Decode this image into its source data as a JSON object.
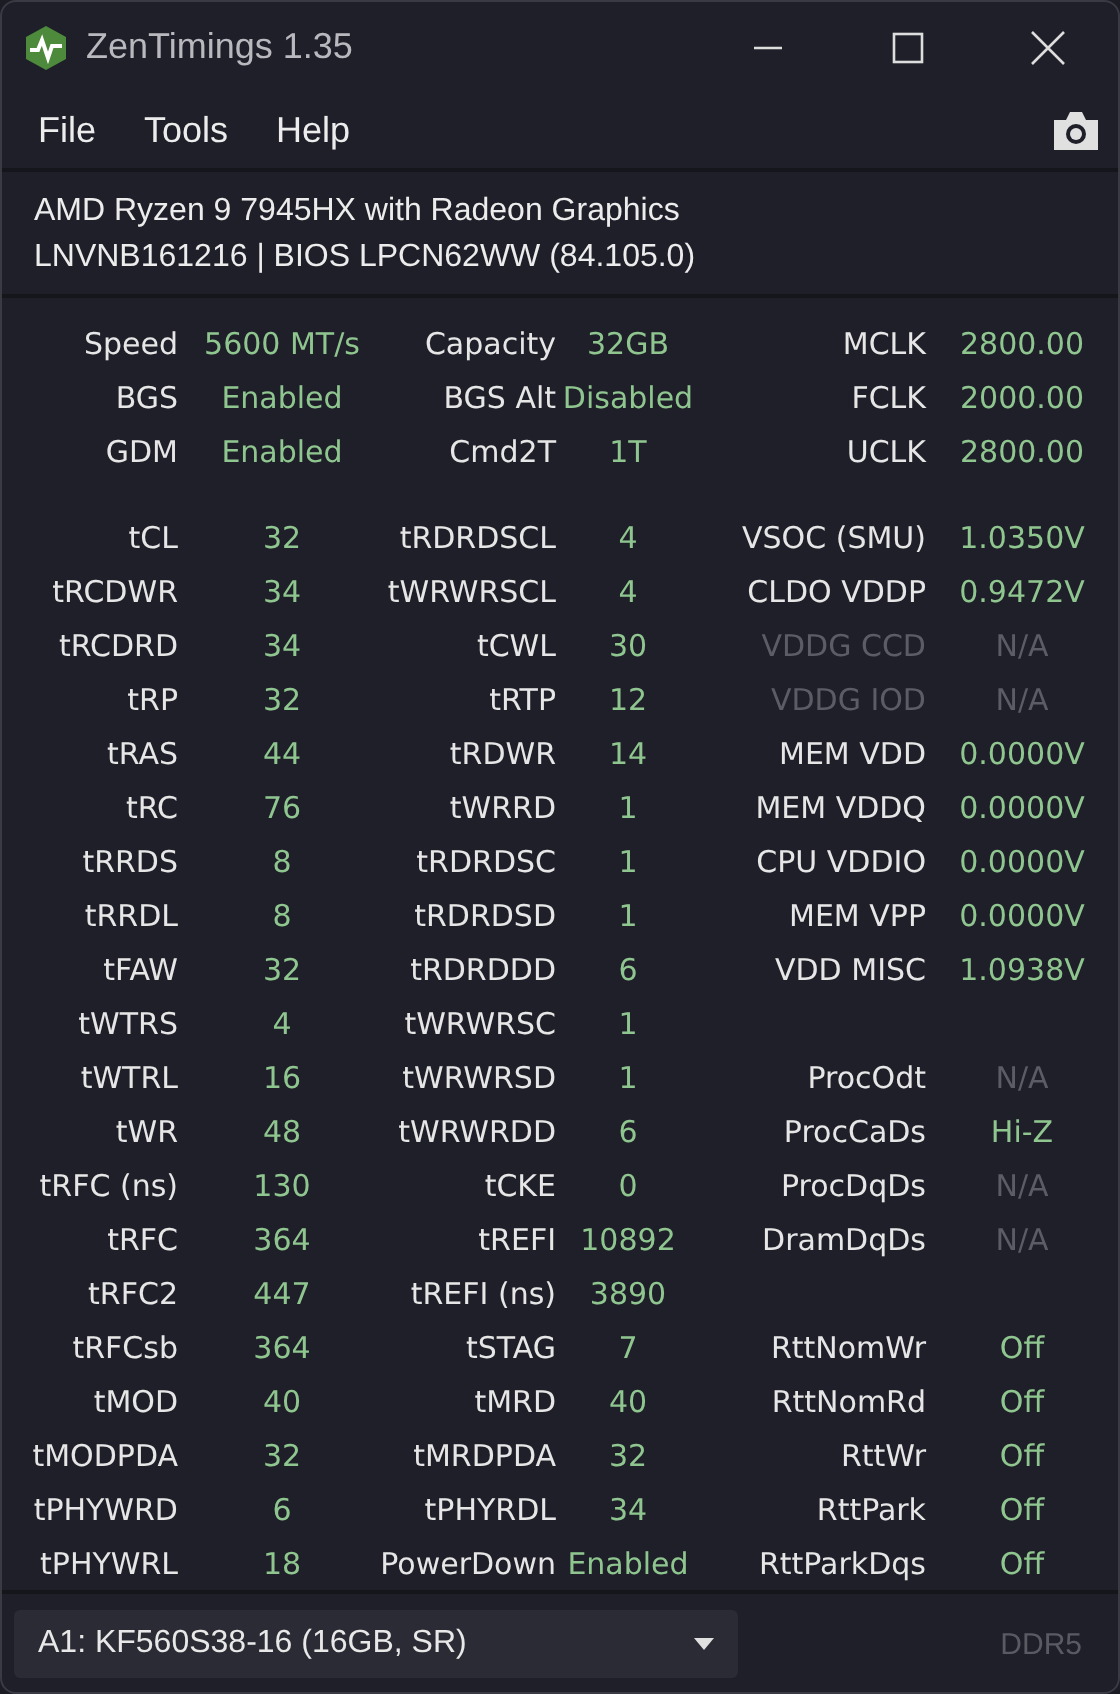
{
  "window": {
    "title": "ZenTimings 1.35"
  },
  "menu": [
    "File",
    "Tools",
    "Help"
  ],
  "info": [
    "AMD Ryzen 9 7945HX with Radeon Graphics",
    "LNVNB161216 | BIOS LPCN62WW (84.105.0)"
  ],
  "summary": [
    {
      "cells": [
        {
          "label": "Speed",
          "value": "5600 MT/s"
        },
        {
          "label": "Capacity",
          "value": "32GB"
        },
        {
          "label": "MCLK",
          "value": "2800.00"
        }
      ]
    },
    {
      "cells": [
        {
          "label": "BGS",
          "value": "Enabled"
        },
        {
          "label": "BGS Alt",
          "value": "Disabled"
        },
        {
          "label": "FCLK",
          "value": "2000.00"
        }
      ]
    },
    {
      "cells": [
        {
          "label": "GDM",
          "value": "Enabled"
        },
        {
          "label": "Cmd2T",
          "value": "1T"
        },
        {
          "label": "UCLK",
          "value": "2800.00"
        }
      ]
    }
  ],
  "timings": [
    {
      "cells": [
        {
          "label": "tCL",
          "value": "32",
          "kind": "normal"
        },
        {
          "label": "tRDRDSCL",
          "value": "4",
          "kind": "normal"
        },
        {
          "label": "VSOC (SMU)",
          "value": "1.0350V",
          "kind": "normal"
        }
      ]
    },
    {
      "cells": [
        {
          "label": "tRCDWR",
          "value": "34",
          "kind": "normal"
        },
        {
          "label": "tWRWRSCL",
          "value": "4",
          "kind": "normal"
        },
        {
          "label": "CLDO VDDP",
          "value": "0.9472V",
          "kind": "normal"
        }
      ]
    },
    {
      "cells": [
        {
          "label": "tRCDRD",
          "value": "34",
          "kind": "normal"
        },
        {
          "label": "tCWL",
          "value": "30",
          "kind": "normal"
        },
        {
          "label": "VDDG CCD",
          "value": "N/A",
          "kind": "disabled"
        }
      ]
    },
    {
      "cells": [
        {
          "label": "tRP",
          "value": "32",
          "kind": "normal"
        },
        {
          "label": "tRTP",
          "value": "12",
          "kind": "normal"
        },
        {
          "label": "VDDG IOD",
          "value": "N/A",
          "kind": "disabled"
        }
      ]
    },
    {
      "cells": [
        {
          "label": "tRAS",
          "value": "44",
          "kind": "normal"
        },
        {
          "label": "tRDWR",
          "value": "14",
          "kind": "normal"
        },
        {
          "label": "MEM VDD",
          "value": "0.0000V",
          "kind": "normal"
        }
      ]
    },
    {
      "cells": [
        {
          "label": "tRC",
          "value": "76",
          "kind": "normal"
        },
        {
          "label": "tWRRD",
          "value": "1",
          "kind": "normal"
        },
        {
          "label": "MEM VDDQ",
          "value": "0.0000V",
          "kind": "normal"
        }
      ]
    },
    {
      "cells": [
        {
          "label": "tRRDS",
          "value": "8",
          "kind": "normal"
        },
        {
          "label": "tRDRDSC",
          "value": "1",
          "kind": "normal"
        },
        {
          "label": "CPU VDDIO",
          "value": "0.0000V",
          "kind": "normal"
        }
      ]
    },
    {
      "cells": [
        {
          "label": "tRRDL",
          "value": "8",
          "kind": "normal"
        },
        {
          "label": "tRDRDSD",
          "value": "1",
          "kind": "normal"
        },
        {
          "label": "MEM VPP",
          "value": "0.0000V",
          "kind": "normal"
        }
      ]
    },
    {
      "cells": [
        {
          "label": "tFAW",
          "value": "32",
          "kind": "normal"
        },
        {
          "label": "tRDRDDD",
          "value": "6",
          "kind": "normal"
        },
        {
          "label": "VDD MISC",
          "value": "1.0938V",
          "kind": "normal"
        }
      ]
    },
    {
      "cells": [
        {
          "label": "tWTRS",
          "value": "4",
          "kind": "normal"
        },
        {
          "label": "tWRWRSC",
          "value": "1",
          "kind": "normal"
        }
      ]
    },
    {
      "cells": [
        {
          "label": "tWTRL",
          "value": "16",
          "kind": "normal"
        },
        {
          "label": "tWRWRSD",
          "value": "1",
          "kind": "normal"
        },
        {
          "label": "ProcOdt",
          "value": "N/A",
          "kind": "na"
        }
      ]
    },
    {
      "cells": [
        {
          "label": "tWR",
          "value": "48",
          "kind": "normal"
        },
        {
          "label": "tWRWRDD",
          "value": "6",
          "kind": "normal"
        },
        {
          "label": "ProcCaDs",
          "value": "Hi-Z",
          "kind": "normal"
        }
      ]
    },
    {
      "cells": [
        {
          "label": "tRFC (ns)",
          "value": "130",
          "kind": "normal"
        },
        {
          "label": "tCKE",
          "value": "0",
          "kind": "normal"
        },
        {
          "label": "ProcDqDs",
          "value": "N/A",
          "kind": "na"
        }
      ]
    },
    {
      "cells": [
        {
          "label": "tRFC",
          "value": "364",
          "kind": "normal"
        },
        {
          "label": "tREFI",
          "value": "10892",
          "kind": "normal"
        },
        {
          "label": "DramDqDs",
          "value": "N/A",
          "kind": "na"
        }
      ]
    },
    {
      "cells": [
        {
          "label": "tRFC2",
          "value": "447",
          "kind": "normal"
        },
        {
          "label": "tREFI (ns)",
          "value": "3890",
          "kind": "normal"
        }
      ]
    },
    {
      "cells": [
        {
          "label": "tRFCsb",
          "value": "364",
          "kind": "normal"
        },
        {
          "label": "tSTAG",
          "value": "7",
          "kind": "normal"
        },
        {
          "label": "RttNomWr",
          "value": "Off",
          "kind": "normal"
        }
      ]
    },
    {
      "cells": [
        {
          "label": "tMOD",
          "value": "40",
          "kind": "normal"
        },
        {
          "label": "tMRD",
          "value": "40",
          "kind": "normal"
        },
        {
          "label": "RttNomRd",
          "value": "Off",
          "kind": "normal"
        }
      ]
    },
    {
      "cells": [
        {
          "label": "tMODPDA",
          "value": "32",
          "kind": "normal"
        },
        {
          "label": "tMRDPDA",
          "value": "32",
          "kind": "normal"
        },
        {
          "label": "RttWr",
          "value": "Off",
          "kind": "normal"
        }
      ]
    },
    {
      "cells": [
        {
          "label": "tPHYWRD",
          "value": "6",
          "kind": "normal"
        },
        {
          "label": "tPHYRDL",
          "value": "34",
          "kind": "normal"
        },
        {
          "label": "RttPark",
          "value": "Off",
          "kind": "normal"
        }
      ]
    },
    {
      "cells": [
        {
          "label": "tPHYWRL",
          "value": "18",
          "kind": "normal"
        },
        {
          "label": "PowerDown",
          "value": "Enabled",
          "kind": "normal"
        },
        {
          "label": "RttParkDqs",
          "value": "Off",
          "kind": "normal"
        }
      ]
    }
  ],
  "footer": {
    "module": "A1: KF560S38-16 (16GB, SR)",
    "memory_type": "DDR5"
  }
}
